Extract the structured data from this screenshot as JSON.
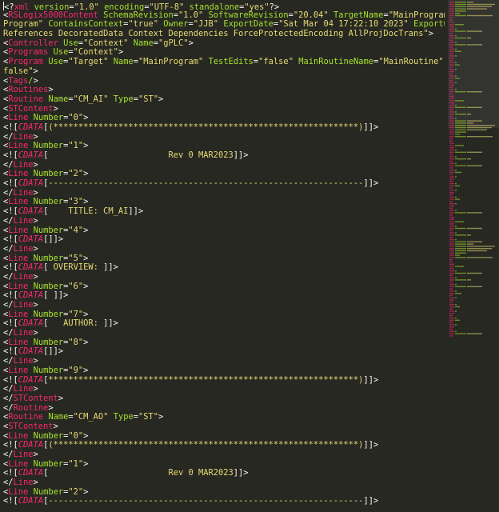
{
  "editor": {
    "lines": [
      "<?xml version=\"1.0\" encoding=\"UTF-8\" standalone=\"yes\"?>",
      "<RSLogix5000Content SchemaRevision=\"1.0\" SoftwareRevision=\"20.04\" TargetName=\"MainProgram\" TargetType=\"",
      "Program\" ContainsContext=\"true\" Owner=\"JJB\" ExportDate=\"Sat Mar 04 17:22:10 2023\" ExportOptions=\"",
      "References DecoratedData Context Dependencies ForceProtectedEncoding AllProjDocTrans\">",
      "<Controller Use=\"Context\" Name=\"gPLC\">",
      "<Programs Use=\"Context\">",
      "<Program Use=\"Target\" Name=\"MainProgram\" TestEdits=\"false\" MainRoutineName=\"MainRoutine\" Disabled=\"",
      "false\">",
      "<Tags/>",
      "<Routines>",
      "<Routine Name=\"CM_AI\" Type=\"ST\">",
      "<STContent>",
      "<Line Number=\"0\">",
      "<![CDATA[(*************************************************************)]]>",
      "</Line>",
      "<Line Number=\"1\">",
      "<![CDATA[                        Rev 0 MAR2023]]>",
      "</Line>",
      "<Line Number=\"2\">",
      "<![CDATA[---------------------------------------------------------------]]>",
      "</Line>",
      "<Line Number=\"3\">",
      "<![CDATA[    TITLE: CM_AI]]>",
      "</Line>",
      "<Line Number=\"4\">",
      "<![CDATA[]]>",
      "</Line>",
      "<Line Number=\"5\">",
      "<![CDATA[ OVERVIEW: ]]>",
      "</Line>",
      "<Line Number=\"6\">",
      "<![CDATA[ ]]>",
      "</Line>",
      "<Line Number=\"7\">",
      "<![CDATA[   AUTHOR: ]]>",
      "</Line>",
      "<Line Number=\"8\">",
      "<![CDATA[]]>",
      "</Line>",
      "<Line Number=\"9\">",
      "<![CDATA[**************************************************************)]]>",
      "</Line>",
      "</STContent>",
      "</Routine>",
      "<Routine Name=\"CM_AO\" Type=\"ST\">",
      "<STContent>",
      "<Line Number=\"0\">",
      "<![CDATA[(*************************************************************)]]>",
      "</Line>",
      "<Line Number=\"1\">",
      "<![CDATA[                        Rev 0 MAR2023]]>",
      "</Line>",
      "<Line Number=\"2\">",
      "<![CDATA[---------------------------------------------------------------]]>"
    ]
  },
  "colors": {
    "background": "#272822",
    "tag": "#f92672",
    "attribute": "#a6e22e",
    "string": "#e6db74",
    "punctuation": "#f8f8f2"
  }
}
